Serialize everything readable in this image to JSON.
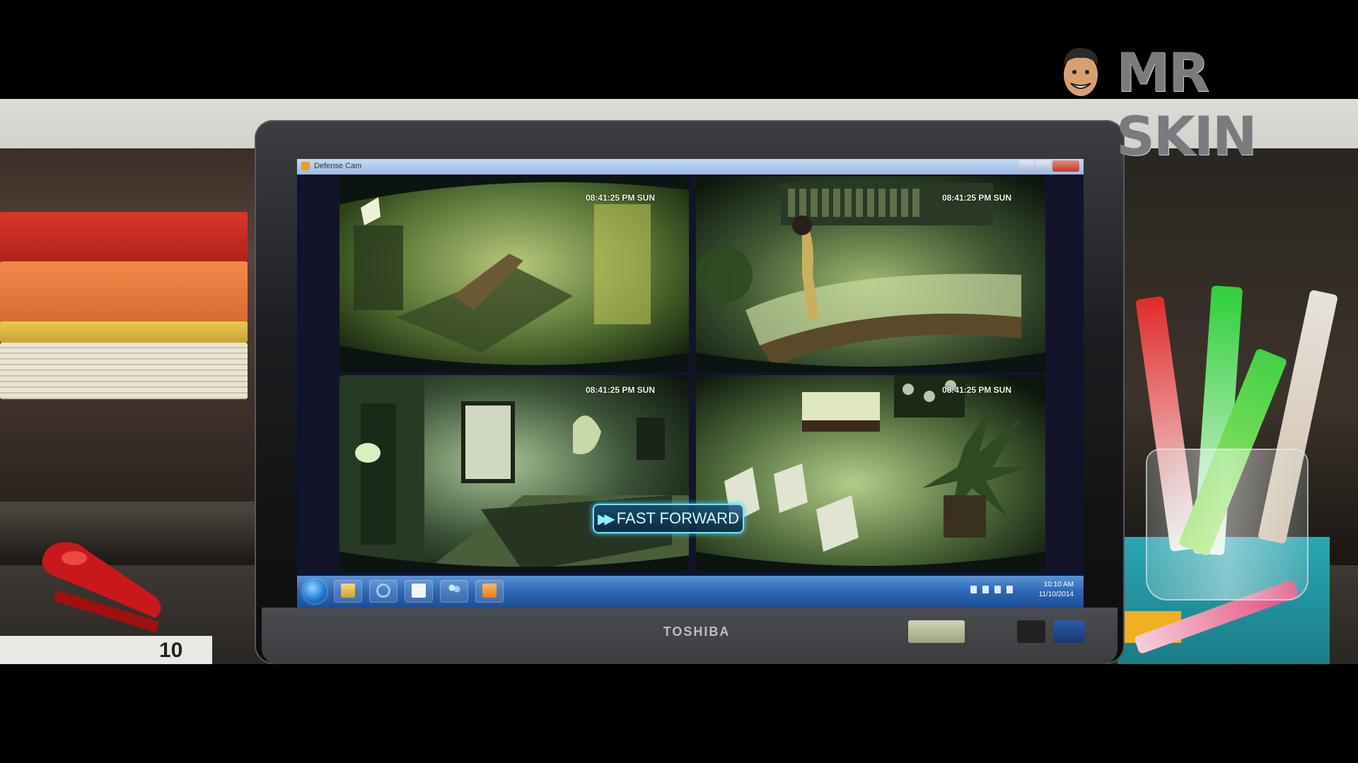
{
  "window": {
    "title": "Defense Cam"
  },
  "cameras": [
    {
      "timestamp": "08:41:25 PM SUN"
    },
    {
      "timestamp": "08:41:25 PM SUN"
    },
    {
      "timestamp": "08:41:25 PM SUN"
    },
    {
      "timestamp": "08:41:25 PM SUN"
    }
  ],
  "playback": {
    "label": "FAST FORWARD",
    "icon": "fast-forward-icon"
  },
  "taskbar": {
    "time": "10:10 AM",
    "date": "11/10/2014",
    "pinned": [
      "start-orb",
      "explorer-icon",
      "internet-explorer-icon",
      "window-icon",
      "contacts-icon",
      "media-player-icon"
    ]
  },
  "monitor": {
    "brand": "TOSHIBA"
  },
  "props": {
    "calendar_day": "10"
  },
  "watermark": {
    "text": "MR SKIN"
  },
  "colors": {
    "screen_tint": "#9fd36a",
    "badge_border": "#6fe3ff",
    "taskbar": "#2d67b4"
  }
}
